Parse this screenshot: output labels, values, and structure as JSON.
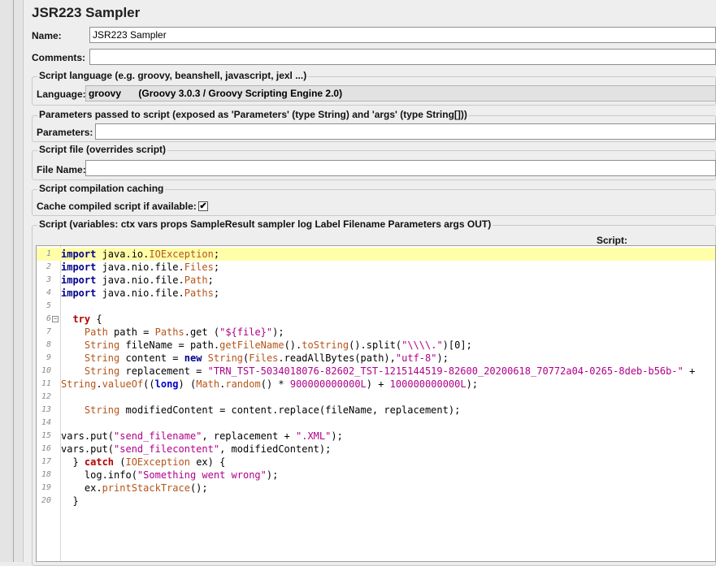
{
  "title": "JSR223 Sampler",
  "name_label": "Name:",
  "name_value": "JSR223 Sampler",
  "comments_label": "Comments:",
  "comments_value": "",
  "language_group": {
    "title": "Script language (e.g. groovy, beanshell, javascript, jexl ...)",
    "label": "Language:",
    "value": "groovy",
    "engine": "(Groovy 3.0.3 / Groovy Scripting Engine 2.0)"
  },
  "params_group": {
    "title": "Parameters passed to script (exposed as 'Parameters' (type String) and 'args' (type String[]))",
    "label": "Parameters:",
    "value": ""
  },
  "file_group": {
    "title": "Script file (overrides script)",
    "label": "File Name:",
    "value": ""
  },
  "caching_group": {
    "title": "Script compilation caching",
    "label": "Cache compiled script if available:",
    "checked": true,
    "check_glyph": "✔"
  },
  "script_group": {
    "title": "Script (variables: ctx vars props SampleResult sampler log Label Filename Parameters args OUT)",
    "script_label": "Script:"
  },
  "code_lines": [
    {
      "n": "1",
      "text": "import java.io.IOException;"
    },
    {
      "n": "2",
      "text": "import java.nio.file.Files;"
    },
    {
      "n": "3",
      "text": "import java.nio.file.Path;"
    },
    {
      "n": "4",
      "text": "import java.nio.file.Paths;"
    },
    {
      "n": "5",
      "text": ""
    },
    {
      "n": "6",
      "text": "  try {"
    },
    {
      "n": "7",
      "text": "    Path path = Paths.get (\"${file}\");"
    },
    {
      "n": "8",
      "text": "    String fileName = path.getFileName().toString().split(\"\\\\\\\\.\")[0];"
    },
    {
      "n": "9",
      "text": "    String content = new String(Files.readAllBytes(path),\"utf-8\");"
    },
    {
      "n": "10",
      "text": "    String replacement = \"TRN_TST-5034018076-82602_TST-1215144519-82600_20200618_70772a04-0265-8deb-b56b-\" +"
    },
    {
      "n": "11",
      "text": "String.valueOf((long) (Math.random() * 900000000000L) + 100000000000L);"
    },
    {
      "n": "12",
      "text": ""
    },
    {
      "n": "13",
      "text": "    String modifiedContent = content.replace(fileName, replacement);"
    },
    {
      "n": "14",
      "text": ""
    },
    {
      "n": "15",
      "text": "vars.put(\"send_filename\", replacement + \".XML\");"
    },
    {
      "n": "16",
      "text": "vars.put(\"send_filecontent\", modifiedContent);"
    },
    {
      "n": "17",
      "text": "  } catch (IOException ex) {"
    },
    {
      "n": "18",
      "text": "    log.info(\"Something went wrong\");"
    },
    {
      "n": "19",
      "text": "    ex.printStackTrace();"
    },
    {
      "n": "20",
      "text": "  }"
    }
  ],
  "colors": {
    "highlight_line": "#ffffaa",
    "keyword": "#00008b",
    "string": "#b0008a",
    "type": "#b5551a"
  }
}
